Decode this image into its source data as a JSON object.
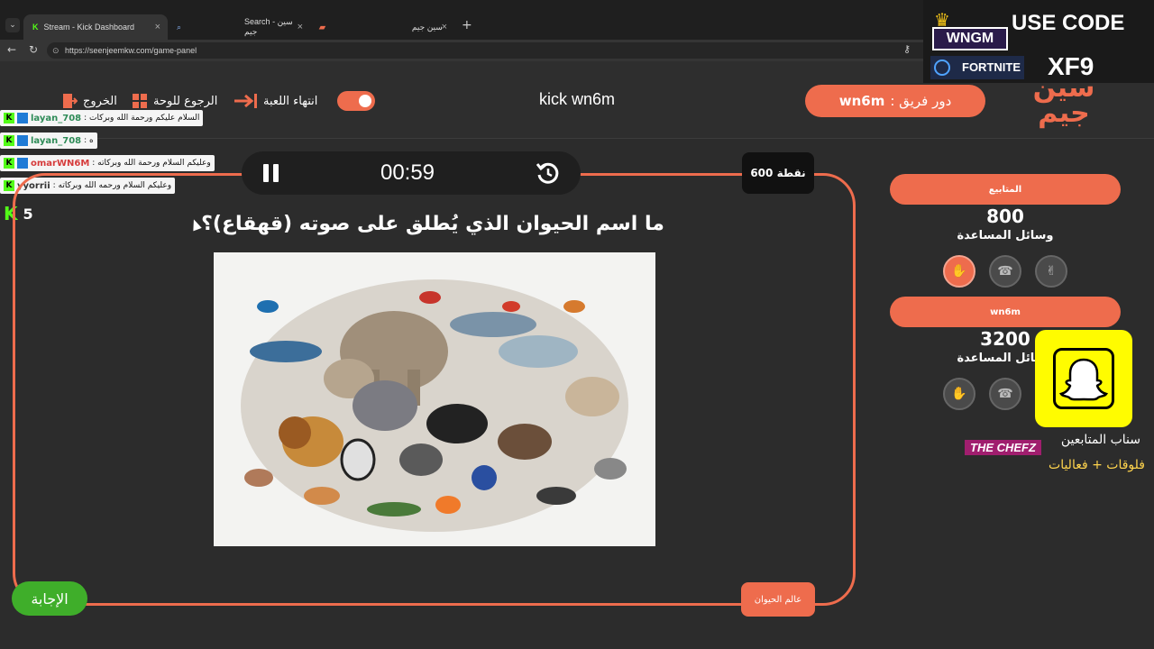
{
  "browser": {
    "tabs": [
      {
        "label": "Stream - Kick Dashboard"
      },
      {
        "label": "Search - سين جيم"
      },
      {
        "label": "سين جيم"
      }
    ],
    "url": "https://seenjeemkw.com/game-panel"
  },
  "header": {
    "exit_label": "الخروج",
    "back_to_board_label": "الرجوع للوحة",
    "end_game_label": "انتهاء اللعبة",
    "center_title": "kick wn6m",
    "turn_label": "دور فريق :",
    "turn_team": "wn6m"
  },
  "chat": [
    {
      "user": "layan_708",
      "message": "السلام عليكم ورحمة الله وبركات :",
      "color": "#2e8b57"
    },
    {
      "user": "layan_708",
      "message": "ه :",
      "color": "#2e8b57"
    },
    {
      "user": "omarWN6M",
      "message": "وعليكم السلام ورحمة الله وبركاته :",
      "color": "#d63b3b"
    },
    {
      "user": "yyorrii",
      "message": "وعليكم السلام ورحمه الله وبركاته :",
      "color": "#333333"
    }
  ],
  "viewer_count": "5",
  "game": {
    "timer": "00:59",
    "points": "600 نقطة",
    "question": "ما اسم الحيوان الذي يُطلق على صوته (قهقاع)؟",
    "answer_button": "الإجابة",
    "category": "عالم الحيوان"
  },
  "teams": [
    {
      "name": "المتابيع",
      "score": "800",
      "aids_label": "وسائل المساعدة"
    },
    {
      "name": "wn6m",
      "score": "3200",
      "aids_label": "وسائل المساعدة"
    }
  ],
  "overlays": {
    "use_code": "USE CODE",
    "code": "XF9",
    "wngm": "WNGM",
    "fortnite": "FORTNITE",
    "chef": "THE CHEFZ",
    "snap_text": "سناب المتابعين",
    "vlog_text": "فلوقات + فعاليات"
  },
  "colors": {
    "accent": "#ee6c4d",
    "answer_green": "#3fae2a",
    "kick_green": "#53fc18"
  }
}
